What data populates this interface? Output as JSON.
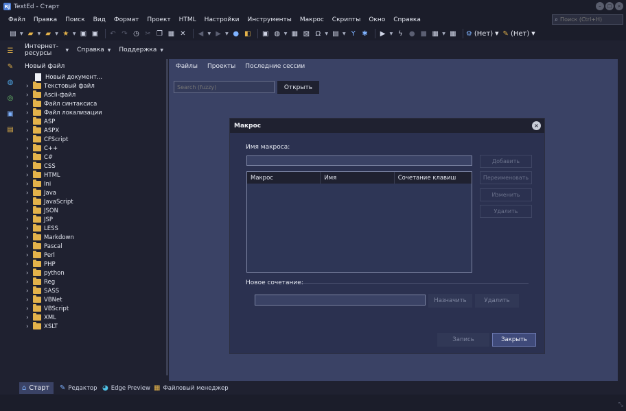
{
  "window": {
    "title": "TextEd - Старт",
    "logo_text": "Rj"
  },
  "menu": [
    "Файл",
    "Правка",
    "Поиск",
    "Вид",
    "Формат",
    "Проект",
    "HTML",
    "Настройки",
    "Инструменты",
    "Макрос",
    "Скрипты",
    "Окно",
    "Справка"
  ],
  "search": {
    "placeholder": "Поиск (Ctrl+H)"
  },
  "toolbar": {
    "dropdown1": "(Нет)",
    "dropdown2": "(Нет)"
  },
  "subbar": [
    "Интернет-ресурсы",
    "Справка",
    "Поддержка"
  ],
  "tree": {
    "root": "Новый файл",
    "new_doc": "Новый документ...",
    "folders": [
      "Текстовый файл",
      "Ascii-файл",
      "Файл синтаксиса",
      "Файл локализации",
      "ASP",
      "ASPX",
      "CFScript",
      "C++",
      "C#",
      "CSS",
      "HTML",
      "Ini",
      "Java",
      "JavaScript",
      "JSON",
      "JSP",
      "LESS",
      "Markdown",
      "Pascal",
      "Perl",
      "PHP",
      "python",
      "Reg",
      "SASS",
      "VBNet",
      "VBScript",
      "XML",
      "XSLT"
    ]
  },
  "main": {
    "tabs": [
      "Файлы",
      "Проекты",
      "Последние сессии"
    ],
    "fuzzy_placeholder": "Search (fuzzy)",
    "open_button": "Открыть"
  },
  "dialog": {
    "title": "Макрос",
    "name_label": "Имя макроса:",
    "columns": [
      "Макрос",
      "Имя",
      "Сочетание клавиш"
    ],
    "side_buttons": [
      "Добавить",
      "Переименовать",
      "Изменить",
      "Удалить"
    ],
    "new_shortcut_label": "Новое сочетание:",
    "assign_button": "Назначить",
    "delete_button": "Удалить",
    "record_button": "Запись",
    "close_button": "Закрыть"
  },
  "bottom_tabs": [
    {
      "label": "Старт",
      "icon": "home-icon"
    },
    {
      "label": "Редактор",
      "icon": "pen-icon"
    },
    {
      "label": "Edge Preview",
      "icon": "edge-icon"
    },
    {
      "label": "Файловый менеджер",
      "icon": "file-manager-icon"
    }
  ],
  "colors": {
    "accent": "#3f4a7a",
    "folder": "#e3b24a",
    "pane": "#3a4265"
  }
}
